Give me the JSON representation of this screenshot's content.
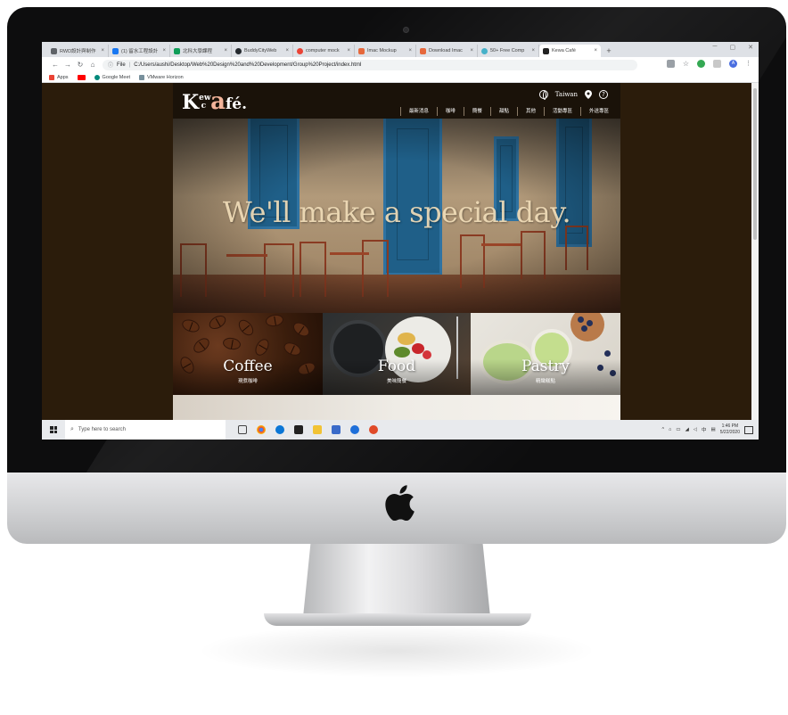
{
  "browser": {
    "tabs": [
      {
        "label": "RWD設計與制作",
        "favicon_color": "#5f6368"
      },
      {
        "label": "(1) 留水工程設計",
        "favicon_color": "#1877f2"
      },
      {
        "label": "北科大學課程",
        "favicon_color": "#0f9d58"
      },
      {
        "label": "BuddyCityWeb",
        "favicon_color": "#24292e"
      },
      {
        "label": "computer mock",
        "favicon_color": "#ea4335"
      },
      {
        "label": "Imac Mockup",
        "favicon_color": "#e6683c"
      },
      {
        "label": "Download Imac",
        "favicon_color": "#e6683c"
      },
      {
        "label": "50+ Free Comp",
        "favicon_color": "#46b1c9"
      },
      {
        "label": "Kewa Café",
        "favicon_color": "#222222",
        "active": true
      }
    ],
    "new_tab_label": "+",
    "address": {
      "scheme_label": "File",
      "url": "C:/Users/aushi/Desktop/Web%20Design%20and%20Development/Group%20Project/index.html"
    },
    "bookmarks": [
      {
        "label": "Apps",
        "color": "#ea4335"
      },
      {
        "label": "",
        "color": "#ff0000"
      },
      {
        "label": "Google Meet",
        "color": "#00897b"
      },
      {
        "label": "VMware Horizon",
        "color": "#78909c"
      }
    ],
    "profile_initial": "A"
  },
  "site": {
    "logo": {
      "part1": "K",
      "part2": "ew",
      "part3": "c",
      "part4": "a",
      "part5": "fé."
    },
    "region_label": "Taiwan",
    "help_label": "?",
    "nav": [
      "最新消息",
      "咖啡",
      "簡餐",
      "甜點",
      "其他",
      "活動專區",
      "外送專區"
    ],
    "hero_tagline": "We'll make a special day.",
    "categories": [
      {
        "title": "Coffee",
        "subtitle": "現煮咖啡"
      },
      {
        "title": "Food",
        "subtitle": "美味簡餐"
      },
      {
        "title": "Pastry",
        "subtitle": "精緻糕點"
      }
    ]
  },
  "taskbar": {
    "search_placeholder": "Type here to search",
    "time": "1:46 PM",
    "date": "5/22/2020",
    "ime_label": "中"
  }
}
